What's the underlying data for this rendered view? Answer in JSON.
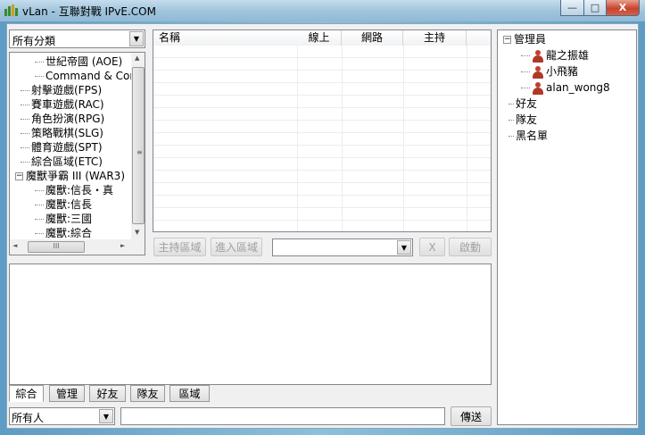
{
  "window": {
    "title": "vLan - 互聯對戰 IPvE.COM",
    "minimize": "—",
    "maximize": "□",
    "close": "X"
  },
  "category_select": {
    "value": "所有分類"
  },
  "category_tree": [
    {
      "label": "世紀帝國 (AOE)",
      "level": 2
    },
    {
      "label": "Command & Conque",
      "level": 2
    },
    {
      "label": "射擊遊戲(FPS)",
      "level": 1
    },
    {
      "label": "賽車遊戲(RAC)",
      "level": 1
    },
    {
      "label": "角色扮演(RPG)",
      "level": 1
    },
    {
      "label": "策略戰棋(SLG)",
      "level": 1
    },
    {
      "label": "體育遊戲(SPT)",
      "level": 1
    },
    {
      "label": "綜合區域(ETC)",
      "level": 1
    },
    {
      "label": "魔獸爭霸 III (WAR3)",
      "level": 1,
      "expander": "−"
    },
    {
      "label": "魔獸:信長・真",
      "level": 2
    },
    {
      "label": "魔獸:信長",
      "level": 2
    },
    {
      "label": "魔獸:三國",
      "level": 2
    },
    {
      "label": "魔獸:綜合",
      "level": 2
    }
  ],
  "room_table": {
    "columns": [
      "名稱",
      "線上",
      "網路",
      "主持",
      ""
    ],
    "rows": []
  },
  "room_actions": {
    "host": "主持區域",
    "enter": "進入區域",
    "room_select": "",
    "clear": "X",
    "start": "啟動"
  },
  "chat_tabs": [
    "綜合",
    "管理",
    "好友",
    "隊友",
    "區域"
  ],
  "chat": {
    "target": "所有人",
    "message": "",
    "send": "傳送"
  },
  "user_tree": {
    "groups": [
      {
        "label": "管理員",
        "expander": "−",
        "members": [
          "龍之振雄",
          "小飛豬",
          "alan_wong8"
        ]
      },
      {
        "label": "好友"
      },
      {
        "label": "隊友"
      },
      {
        "label": "黑名單"
      }
    ]
  }
}
